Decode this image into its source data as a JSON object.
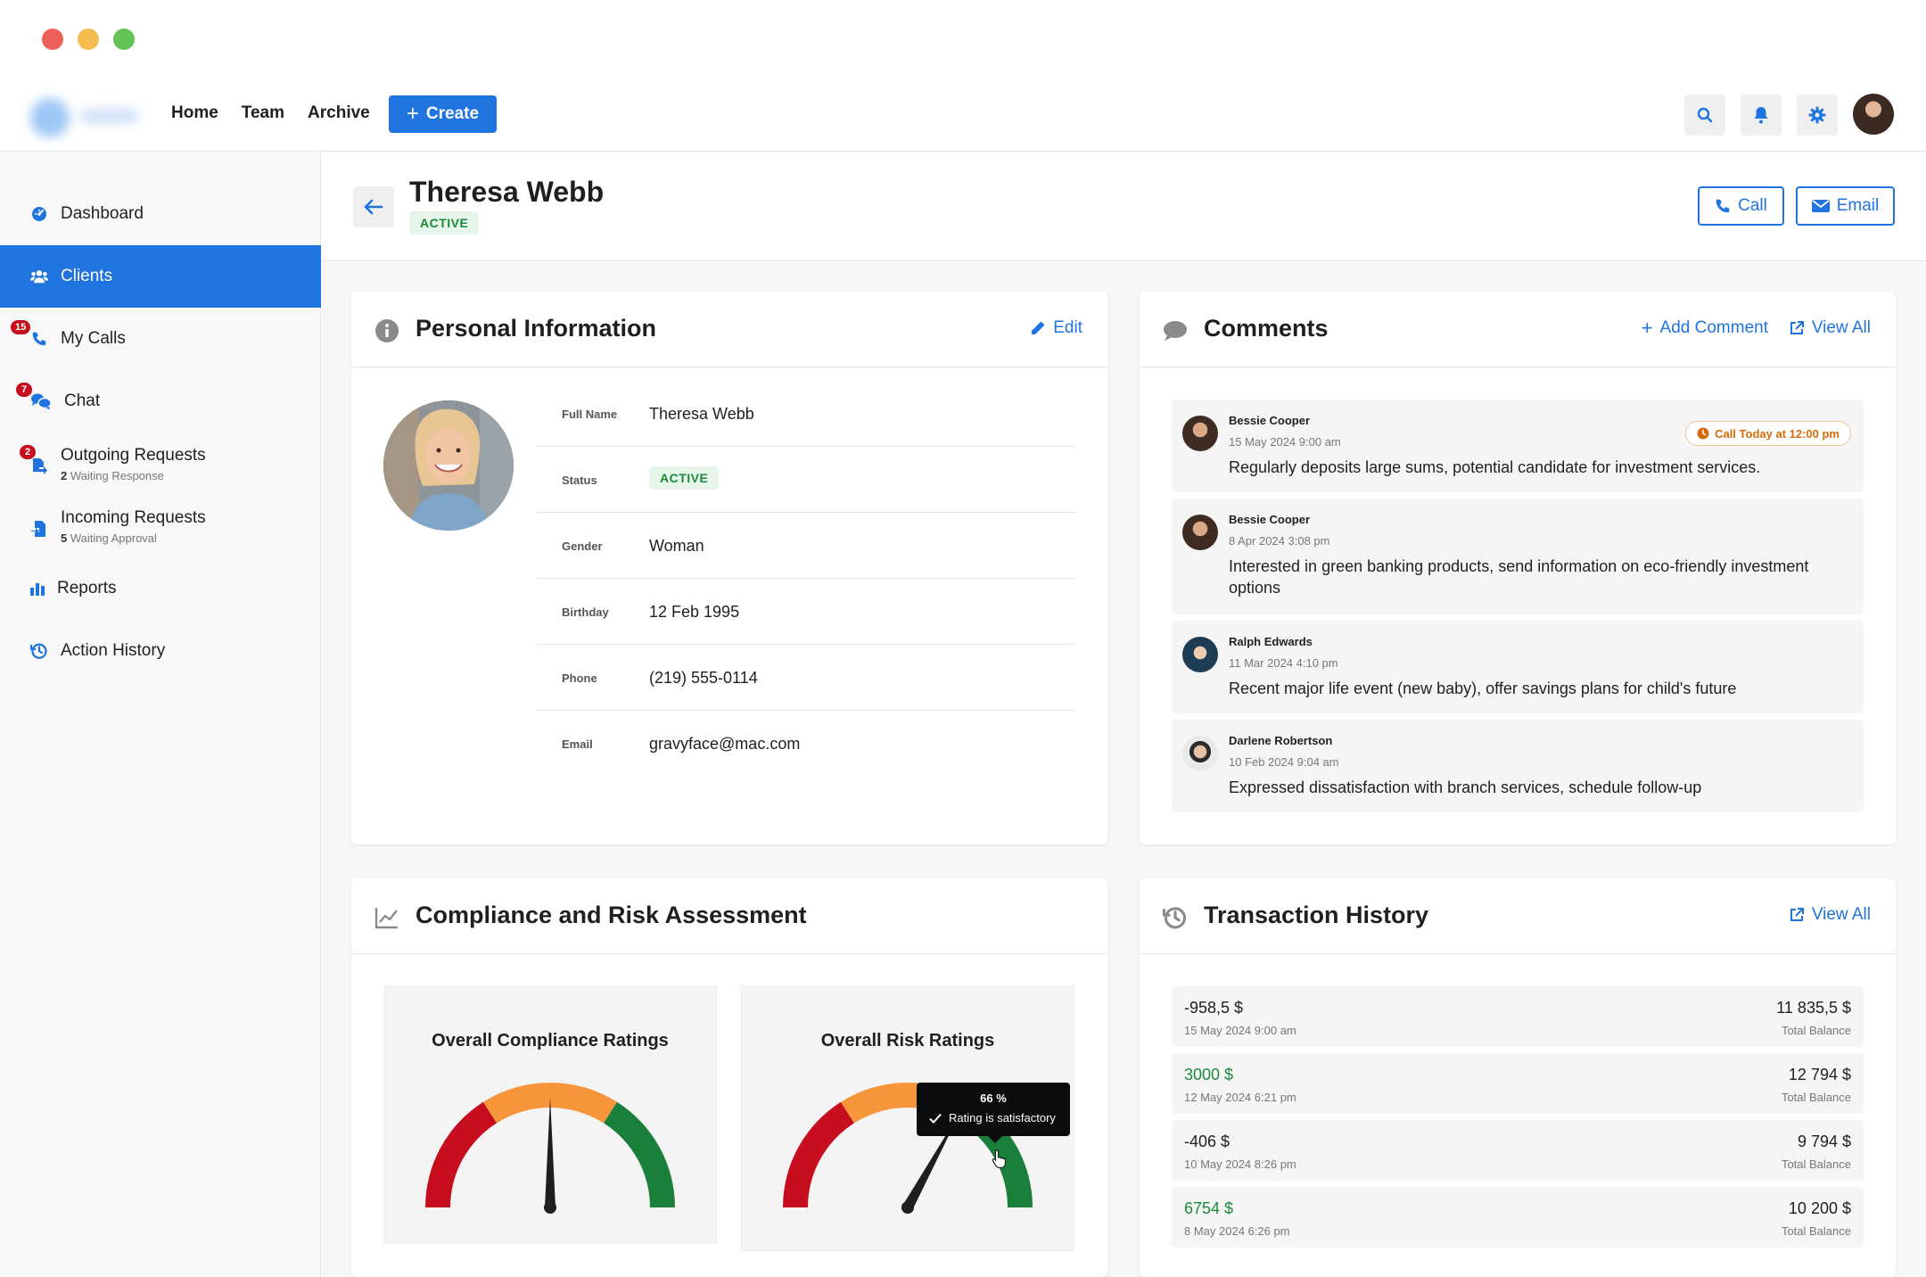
{
  "nav": {
    "links": [
      "Home",
      "Team",
      "Archive"
    ],
    "create_label": "Create",
    "icons": [
      "search-icon",
      "bell-icon",
      "gear-icon"
    ]
  },
  "sidebar": {
    "items": [
      {
        "label": "Dashboard",
        "icon": "dashboard-icon"
      },
      {
        "label": "Clients",
        "icon": "users-icon",
        "active": true
      },
      {
        "label": "My Calls",
        "icon": "phone-icon",
        "badge": "15"
      },
      {
        "label": "Chat",
        "icon": "chat-icon",
        "badge": "7"
      },
      {
        "label": "Outgoing Requests",
        "icon": "outgoing-icon",
        "badge": "2",
        "sub_count": "2",
        "sub_text": "Waiting Response"
      },
      {
        "label": "Incoming Requests",
        "icon": "incoming-icon",
        "sub_count": "5",
        "sub_text": "Waiting Approval"
      },
      {
        "label": "Reports",
        "icon": "bar-chart-icon"
      },
      {
        "label": "Action History",
        "icon": "history-icon"
      }
    ]
  },
  "header": {
    "name": "Theresa Webb",
    "status": "ACTIVE",
    "call_label": "Call",
    "email_label": "Email"
  },
  "personal": {
    "title": "Personal Information",
    "edit_label": "Edit",
    "rows": [
      {
        "label": "Full Name",
        "value": "Theresa Webb"
      },
      {
        "label": "Status",
        "value": "ACTIVE"
      },
      {
        "label": "Gender",
        "value": "Woman"
      },
      {
        "label": "Birthday",
        "value": "12 Feb 1995"
      },
      {
        "label": "Phone",
        "value": "(219) 555-0114"
      },
      {
        "label": "Email",
        "value": "gravyface@mac.com"
      }
    ]
  },
  "comments": {
    "title": "Comments",
    "add_label": "Add Comment",
    "view_all_label": "View All",
    "items": [
      {
        "author": "Bessie Cooper",
        "date": "15 May 2024 9:00 am",
        "text": "Regularly deposits large sums, potential candidate for investment services.",
        "tag": "Call Today at 12:00 pm"
      },
      {
        "author": "Bessie Cooper",
        "date": "8 Apr 2024 3:08 pm",
        "text": "Interested in green banking products, send information on eco-friendly investment options"
      },
      {
        "author": "Ralph Edwards",
        "date": "11 Mar 2024 4:10 pm",
        "text": "Recent major life event (new baby), offer savings plans for child's future"
      },
      {
        "author": "Darlene Robertson",
        "date": "10 Feb 2024 9:04 am",
        "text": "Expressed dissatisfaction with branch services, schedule follow-up"
      }
    ]
  },
  "compliance": {
    "title": "Compliance and Risk Assessment",
    "gauges": [
      {
        "title": "Overall Compliance Ratings",
        "value_fraction": 0.5
      },
      {
        "title": "Overall Risk Ratings",
        "value_fraction": 0.66,
        "tooltip_value": "66 %",
        "tooltip_text": "Rating is satisfactory"
      }
    ],
    "colors": {
      "red": "#c60e1e",
      "orange": "#f7953a",
      "green": "#1a7f3b"
    }
  },
  "transactions": {
    "title": "Transaction History",
    "view_all_label": "View All",
    "balance_label": "Total Balance",
    "items": [
      {
        "amount": "-958,5 $",
        "date": "15 May 2024 9:00 am",
        "balance": "11 835,5 $",
        "positive": false
      },
      {
        "amount": "3000 $",
        "date": "12 May 2024 6:21 pm",
        "balance": "12 794 $",
        "positive": true
      },
      {
        "amount": "-406 $",
        "date": "10 May 2024 8:26 pm",
        "balance": "9 794 $",
        "positive": false
      },
      {
        "amount": "6754 $",
        "date": "8 May 2024 6:26 pm",
        "balance": "10 200 $",
        "positive": true
      }
    ]
  },
  "theme": {
    "accent": "#1f74e0",
    "success": "#1a8a3a",
    "danger": "#c60e1e"
  }
}
